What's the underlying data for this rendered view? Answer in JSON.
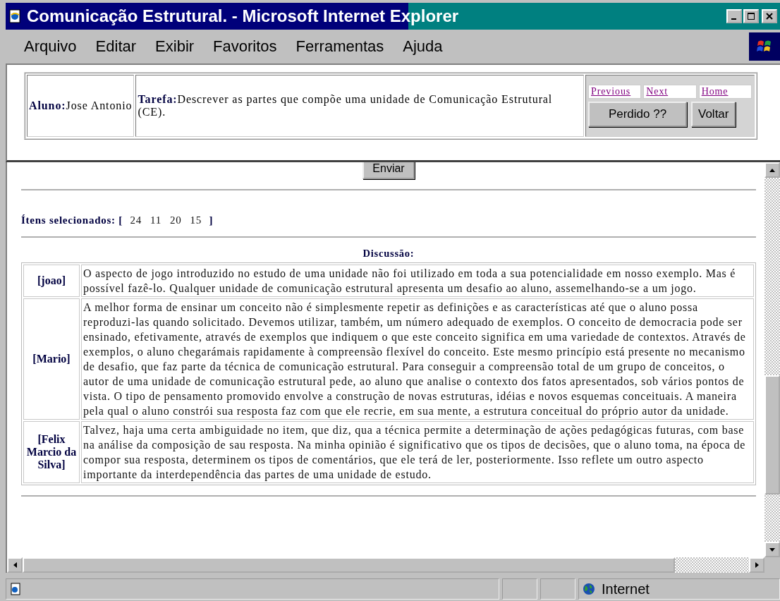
{
  "window": {
    "title": "Comunicação Estrutural. - Microsoft Internet Explorer"
  },
  "menu": [
    "Arquivo",
    "Editar",
    "Exibir",
    "Favoritos",
    "Ferramentas",
    "Ajuda"
  ],
  "header": {
    "student": "**Aluno:**Jose Antonio",
    "task": "**Tarefa:**Descrever as partes que compõe uma unidade de Comunicação Estrutural (CE).",
    "links": [
      "Previous",
      "Next",
      "Home"
    ],
    "buttons": [
      "Perdido ??",
      "Voltar"
    ]
  },
  "form": {
    "submit_button": "Enviar"
  },
  "selected_items": {
    "label": "Ítens selecionados: [",
    "values": [
      "24",
      "11",
      "20",
      "15"
    ],
    "close": "]"
  },
  "discussion": {
    "title": "Discussão:",
    "posts": [
      {
        "author": "[joao]",
        "text": "O aspecto de jogo introduzido no estudo de uma unidade não foi utilizado em toda a sua potencialidade em nosso exemplo. Mas é possível fazê-lo. Qualquer unidade de comunicação estrutural apresenta um desafio ao aluno, assemelhando-se a um jogo."
      },
      {
        "author": "[Mario]",
        "text": "A melhor forma de ensinar um conceito não é simplesmente repetir as definições e as características até que o aluno possa reproduzi-las quando solicitado. Devemos utilizar, também, um número adequado de exemplos. O conceito de democracia pode ser ensinado, efetivamente, através de exemplos que indiquem o que este conceito significa em uma variedade de contextos. Através de exemplos, o aluno chegarámais rapidamente à compreensão flexível do conceito. Este mesmo princípio está presente no mecanismo de desafio, que faz parte da técnica de comunicação estrutural. Para conseguir a compreensão total de um grupo de conceitos, o autor de uma unidade de comunicação estrutural pede, ao aluno que analise o contexto dos fatos apresentados, sob vários pontos de vista. O tipo de pensamento promovido envolve a construção de novas estruturas, idéias e novos esquemas conceituais. A maneira pela qual o aluno constrói sua resposta faz com que ele recrie, em sua mente, a estrutura conceitual do próprio autor da unidade."
      },
      {
        "author": "[Felix Marcio da Silva]",
        "text": "Talvez, haja uma certa ambiguidade no item, que diz, qua a técnica permite a determinação de ações pedagógicas futuras, com base na análise da composição de sau resposta. Na minha opinião é significativo que os tipos de decisões, que o aluno toma, na época de compor sua resposta, determinem os tipos de comentários, que ele terá de ler, posteriormente. Isso reflete um outro aspecto importante da interdependência das partes de uma unidade de estudo."
      }
    ]
  },
  "status_bar": {
    "zone": "Internet"
  }
}
